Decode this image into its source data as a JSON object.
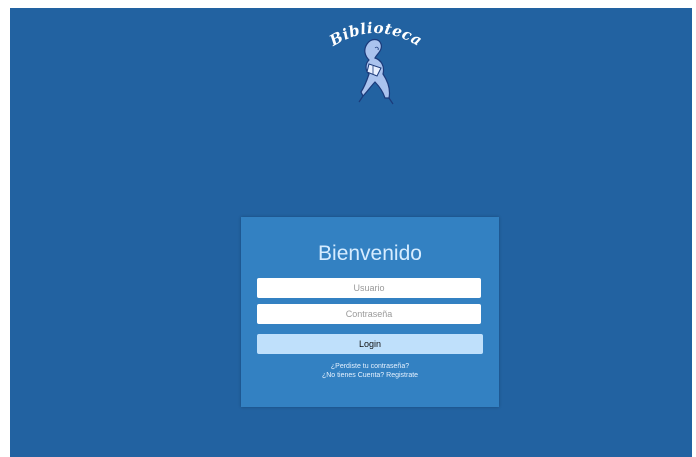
{
  "logo": {
    "text": "Biblioteca"
  },
  "login": {
    "title": "Bienvenido",
    "username_placeholder": "Usuario",
    "password_placeholder": "Contraseña",
    "button_label": "Login",
    "forgot_password_link": "¿Perdiste tu contraseña?",
    "register_link": "¿No tienes Cuenta? Registrate"
  },
  "colors": {
    "background": "#2262a1",
    "card": "#3381c2",
    "button": "#bfe0fb",
    "title_text": "#d6ecff"
  }
}
